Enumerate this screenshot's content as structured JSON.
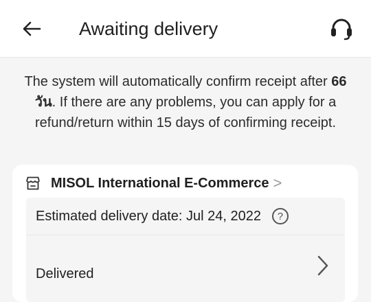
{
  "header": {
    "title": "Awaiting delivery",
    "back_icon": "arrow-left-icon",
    "support_icon": "headset-icon"
  },
  "notice": {
    "prefix": "The system will automatically confirm receipt after",
    "days": "66 วัน",
    "suffix": ". If there are any problems, you can apply for a refund/return within 15 days of confirming receipt."
  },
  "store": {
    "icon": "store-icon",
    "name": "MISOL International E-Commerce",
    "chevron": ">"
  },
  "delivery": {
    "estimated_label": "Estimated delivery date: Jul 24, 2022",
    "help_glyph": "?",
    "status": "Delivered"
  },
  "colors": {
    "background": "#f5f5f5",
    "card": "#ffffff",
    "text": "#1f1f1f"
  }
}
